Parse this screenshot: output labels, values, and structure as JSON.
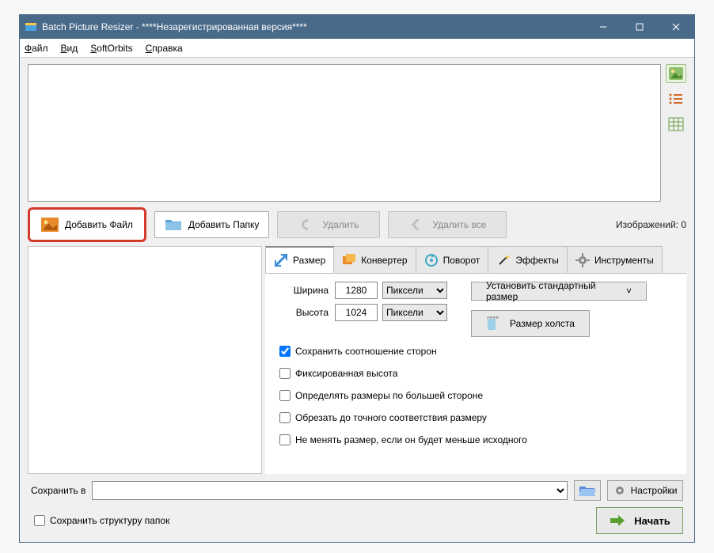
{
  "title": "Batch Picture Resizer - ****Незарегистрированная версия****",
  "menu": {
    "file": "Файл",
    "view": "Вид",
    "softorbits": "SoftOrbits",
    "help": "Справка"
  },
  "toolbar": {
    "add_file": "Добавить Файл",
    "add_folder": "Добавить Папку",
    "delete": "Удалить",
    "delete_all": "Удалить все"
  },
  "images_count_label": "Изображений: 0",
  "tabs": {
    "size": "Размер",
    "converter": "Конвертер",
    "rotate": "Поворот",
    "effects": "Эффекты",
    "tools": "Инструменты"
  },
  "size_panel": {
    "width_label": "Ширина",
    "height_label": "Высота",
    "width": "1280",
    "height": "1024",
    "unit": "Пиксели",
    "std_size": "Установить стандартный размер",
    "canvas_size": "Размер холста",
    "chk_aspect": "Сохранить соотношение сторон",
    "chk_fixed_h": "Фиксированная высота",
    "chk_longest": "Определять размеры по большей стороне",
    "chk_crop": "Обрезать до точного соответствия размеру",
    "chk_no_enlarge": "Не менять размер, если он будет меньше исходного"
  },
  "bottom": {
    "save_in": "Сохранить в",
    "settings": "Настройки",
    "keep_structure": "Сохранить структуру папок",
    "start": "Начать"
  }
}
